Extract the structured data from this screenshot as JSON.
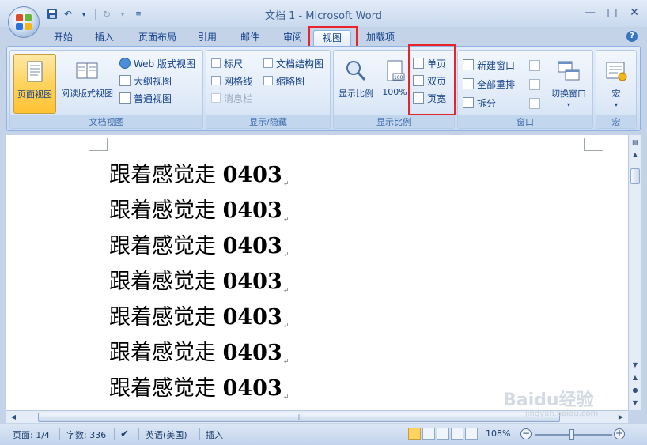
{
  "window": {
    "title": "文档 1 - Microsoft Word",
    "controls": [
      "—",
      "□",
      "✕"
    ]
  },
  "tabs": [
    "开始",
    "插入",
    "页面布局",
    "引用",
    "邮件",
    "审阅",
    "视图",
    "加载项"
  ],
  "active_tab": "视图",
  "ribbon": {
    "doc_views": {
      "label": "文档视图",
      "print_layout": "页面视图",
      "reading": "阅读版式视图",
      "web": "Web 版式视图",
      "outline": "大纲视图",
      "draft": "普通视图"
    },
    "show_hide": {
      "label": "显示/隐藏",
      "ruler": "标尺",
      "gridlines": "网格线",
      "message_bar": "消息栏",
      "doc_map": "文档结构图",
      "thumbnails": "缩略图"
    },
    "zoom": {
      "label": "显示比例",
      "zoom": "显示比例",
      "hundred": "100%",
      "one_page": "单页",
      "two_pages": "双页",
      "page_width": "页宽"
    },
    "window": {
      "label": "窗口",
      "new_window": "新建窗口",
      "arrange_all": "全部重排",
      "split": "拆分",
      "switch_windows": "切换窗口"
    },
    "macros": {
      "label": "宏",
      "macros": "宏"
    }
  },
  "document": {
    "lines": [
      {
        "text": "跟着感觉走",
        "num": "0403"
      },
      {
        "text": "跟着感觉走",
        "num": "0403"
      },
      {
        "text": "跟着感觉走",
        "num": "0403"
      },
      {
        "text": "跟着感觉走",
        "num": "0403"
      },
      {
        "text": "跟着感觉走",
        "num": "0403"
      },
      {
        "text": "跟着感觉走",
        "num": "0403"
      },
      {
        "text": "跟着感觉走",
        "num": "0403"
      }
    ],
    "para_mark": "↵"
  },
  "status": {
    "page": "页面: 1/4",
    "words": "字数: 336",
    "language": "英语(美国)",
    "mode": "插入",
    "zoom": "108%"
  },
  "watermark": {
    "brand": "Baidu经验",
    "url": "jingyan.baidu.com"
  },
  "colors": {
    "highlight": "#e8242a",
    "accent": "#15428b",
    "selected": "#ffd35e"
  }
}
